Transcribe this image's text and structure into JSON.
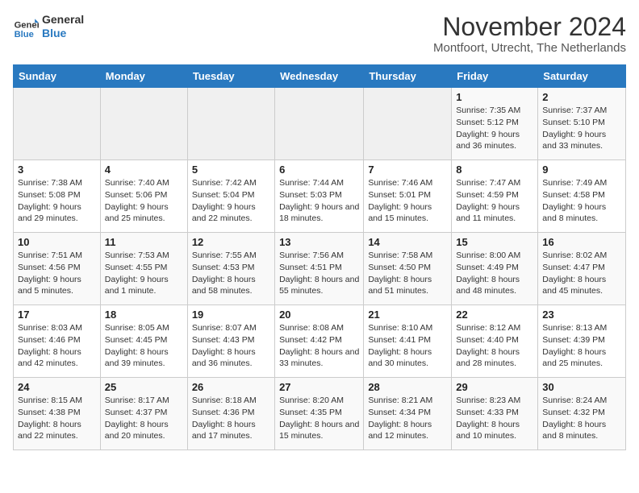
{
  "logo": {
    "line1": "General",
    "line2": "Blue"
  },
  "title": "November 2024",
  "subtitle": "Montfoort, Utrecht, The Netherlands",
  "weekdays": [
    "Sunday",
    "Monday",
    "Tuesday",
    "Wednesday",
    "Thursday",
    "Friday",
    "Saturday"
  ],
  "weeks": [
    [
      {
        "day": "",
        "sunrise": "",
        "sunset": "",
        "daylight": ""
      },
      {
        "day": "",
        "sunrise": "",
        "sunset": "",
        "daylight": ""
      },
      {
        "day": "",
        "sunrise": "",
        "sunset": "",
        "daylight": ""
      },
      {
        "day": "",
        "sunrise": "",
        "sunset": "",
        "daylight": ""
      },
      {
        "day": "",
        "sunrise": "",
        "sunset": "",
        "daylight": ""
      },
      {
        "day": "1",
        "sunrise": "Sunrise: 7:35 AM",
        "sunset": "Sunset: 5:12 PM",
        "daylight": "Daylight: 9 hours and 36 minutes."
      },
      {
        "day": "2",
        "sunrise": "Sunrise: 7:37 AM",
        "sunset": "Sunset: 5:10 PM",
        "daylight": "Daylight: 9 hours and 33 minutes."
      }
    ],
    [
      {
        "day": "3",
        "sunrise": "Sunrise: 7:38 AM",
        "sunset": "Sunset: 5:08 PM",
        "daylight": "Daylight: 9 hours and 29 minutes."
      },
      {
        "day": "4",
        "sunrise": "Sunrise: 7:40 AM",
        "sunset": "Sunset: 5:06 PM",
        "daylight": "Daylight: 9 hours and 25 minutes."
      },
      {
        "day": "5",
        "sunrise": "Sunrise: 7:42 AM",
        "sunset": "Sunset: 5:04 PM",
        "daylight": "Daylight: 9 hours and 22 minutes."
      },
      {
        "day": "6",
        "sunrise": "Sunrise: 7:44 AM",
        "sunset": "Sunset: 5:03 PM",
        "daylight": "Daylight: 9 hours and 18 minutes."
      },
      {
        "day": "7",
        "sunrise": "Sunrise: 7:46 AM",
        "sunset": "Sunset: 5:01 PM",
        "daylight": "Daylight: 9 hours and 15 minutes."
      },
      {
        "day": "8",
        "sunrise": "Sunrise: 7:47 AM",
        "sunset": "Sunset: 4:59 PM",
        "daylight": "Daylight: 9 hours and 11 minutes."
      },
      {
        "day": "9",
        "sunrise": "Sunrise: 7:49 AM",
        "sunset": "Sunset: 4:58 PM",
        "daylight": "Daylight: 9 hours and 8 minutes."
      }
    ],
    [
      {
        "day": "10",
        "sunrise": "Sunrise: 7:51 AM",
        "sunset": "Sunset: 4:56 PM",
        "daylight": "Daylight: 9 hours and 5 minutes."
      },
      {
        "day": "11",
        "sunrise": "Sunrise: 7:53 AM",
        "sunset": "Sunset: 4:55 PM",
        "daylight": "Daylight: 9 hours and 1 minute."
      },
      {
        "day": "12",
        "sunrise": "Sunrise: 7:55 AM",
        "sunset": "Sunset: 4:53 PM",
        "daylight": "Daylight: 8 hours and 58 minutes."
      },
      {
        "day": "13",
        "sunrise": "Sunrise: 7:56 AM",
        "sunset": "Sunset: 4:51 PM",
        "daylight": "Daylight: 8 hours and 55 minutes."
      },
      {
        "day": "14",
        "sunrise": "Sunrise: 7:58 AM",
        "sunset": "Sunset: 4:50 PM",
        "daylight": "Daylight: 8 hours and 51 minutes."
      },
      {
        "day": "15",
        "sunrise": "Sunrise: 8:00 AM",
        "sunset": "Sunset: 4:49 PM",
        "daylight": "Daylight: 8 hours and 48 minutes."
      },
      {
        "day": "16",
        "sunrise": "Sunrise: 8:02 AM",
        "sunset": "Sunset: 4:47 PM",
        "daylight": "Daylight: 8 hours and 45 minutes."
      }
    ],
    [
      {
        "day": "17",
        "sunrise": "Sunrise: 8:03 AM",
        "sunset": "Sunset: 4:46 PM",
        "daylight": "Daylight: 8 hours and 42 minutes."
      },
      {
        "day": "18",
        "sunrise": "Sunrise: 8:05 AM",
        "sunset": "Sunset: 4:45 PM",
        "daylight": "Daylight: 8 hours and 39 minutes."
      },
      {
        "day": "19",
        "sunrise": "Sunrise: 8:07 AM",
        "sunset": "Sunset: 4:43 PM",
        "daylight": "Daylight: 8 hours and 36 minutes."
      },
      {
        "day": "20",
        "sunrise": "Sunrise: 8:08 AM",
        "sunset": "Sunset: 4:42 PM",
        "daylight": "Daylight: 8 hours and 33 minutes."
      },
      {
        "day": "21",
        "sunrise": "Sunrise: 8:10 AM",
        "sunset": "Sunset: 4:41 PM",
        "daylight": "Daylight: 8 hours and 30 minutes."
      },
      {
        "day": "22",
        "sunrise": "Sunrise: 8:12 AM",
        "sunset": "Sunset: 4:40 PM",
        "daylight": "Daylight: 8 hours and 28 minutes."
      },
      {
        "day": "23",
        "sunrise": "Sunrise: 8:13 AM",
        "sunset": "Sunset: 4:39 PM",
        "daylight": "Daylight: 8 hours and 25 minutes."
      }
    ],
    [
      {
        "day": "24",
        "sunrise": "Sunrise: 8:15 AM",
        "sunset": "Sunset: 4:38 PM",
        "daylight": "Daylight: 8 hours and 22 minutes."
      },
      {
        "day": "25",
        "sunrise": "Sunrise: 8:17 AM",
        "sunset": "Sunset: 4:37 PM",
        "daylight": "Daylight: 8 hours and 20 minutes."
      },
      {
        "day": "26",
        "sunrise": "Sunrise: 8:18 AM",
        "sunset": "Sunset: 4:36 PM",
        "daylight": "Daylight: 8 hours and 17 minutes."
      },
      {
        "day": "27",
        "sunrise": "Sunrise: 8:20 AM",
        "sunset": "Sunset: 4:35 PM",
        "daylight": "Daylight: 8 hours and 15 minutes."
      },
      {
        "day": "28",
        "sunrise": "Sunrise: 8:21 AM",
        "sunset": "Sunset: 4:34 PM",
        "daylight": "Daylight: 8 hours and 12 minutes."
      },
      {
        "day": "29",
        "sunrise": "Sunrise: 8:23 AM",
        "sunset": "Sunset: 4:33 PM",
        "daylight": "Daylight: 8 hours and 10 minutes."
      },
      {
        "day": "30",
        "sunrise": "Sunrise: 8:24 AM",
        "sunset": "Sunset: 4:32 PM",
        "daylight": "Daylight: 8 hours and 8 minutes."
      }
    ]
  ]
}
